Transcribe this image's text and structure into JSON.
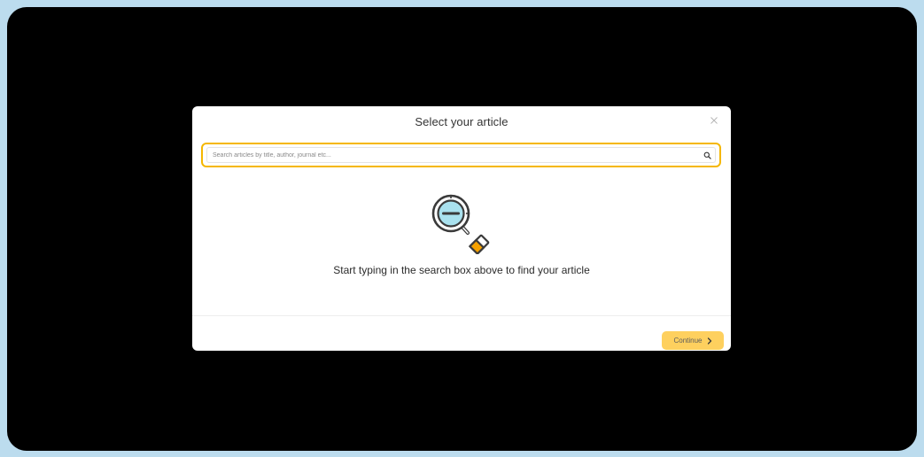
{
  "modal": {
    "title": "Select your article",
    "close_icon": "close-icon"
  },
  "search": {
    "placeholder": "Search articles by title, author, journal etc...",
    "value": "",
    "icon": "search-icon",
    "accent_color": "#f5b700"
  },
  "empty_state": {
    "illustration": "magnifying-glass-minus-icon",
    "message": "Start typing in the search box above to find your article"
  },
  "footer": {
    "continue_label": "Continue",
    "continue_icon": "chevron-right-icon",
    "button_color": "#fed05e"
  }
}
